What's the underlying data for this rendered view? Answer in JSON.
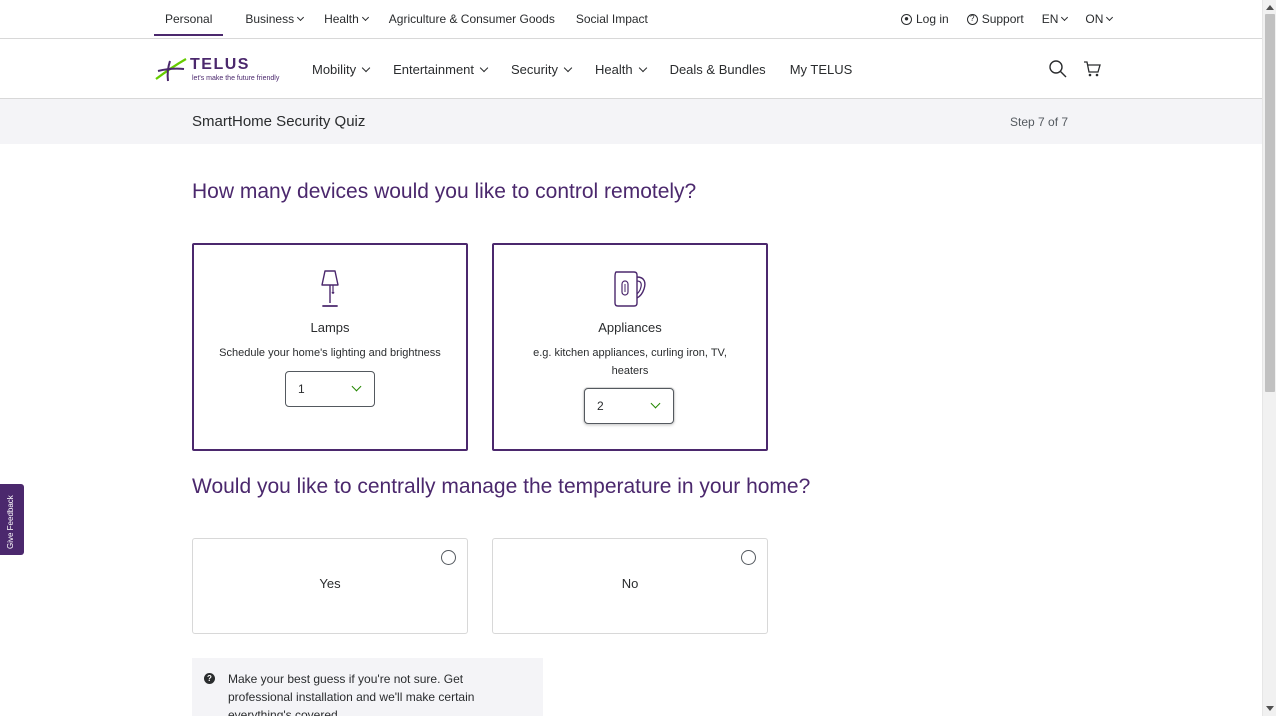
{
  "utility_nav": {
    "left": [
      {
        "label": "Personal",
        "dropdown": false,
        "active": true
      },
      {
        "label": "Business",
        "dropdown": true
      },
      {
        "label": "Health",
        "dropdown": true
      },
      {
        "label": "Agriculture & Consumer Goods",
        "dropdown": false
      },
      {
        "label": "Social Impact",
        "dropdown": false
      }
    ],
    "login": "Log in",
    "support": "Support",
    "language": "EN",
    "province": "ON"
  },
  "logo": {
    "word": "TELUS",
    "tagline": "let's make the future friendly"
  },
  "main_nav": {
    "items": [
      {
        "label": "Mobility",
        "dropdown": true
      },
      {
        "label": "Entertainment",
        "dropdown": true
      },
      {
        "label": "Security",
        "dropdown": true
      },
      {
        "label": "Health",
        "dropdown": true
      },
      {
        "label": "Deals & Bundles",
        "dropdown": false
      },
      {
        "label": "My TELUS",
        "dropdown": false
      }
    ],
    "icons": [
      "search-icon",
      "cart-icon"
    ]
  },
  "quiz": {
    "title": "SmartHome Security Quiz",
    "step": "Step 7 of 7"
  },
  "question1": {
    "text": "How many devices would you like to control remotely?",
    "cards": [
      {
        "label": "Lamps",
        "desc": "Schedule your home's lighting and brightness",
        "value": "1",
        "icon": "lamp-icon"
      },
      {
        "label": "Appliances",
        "desc": "e.g. kitchen appliances, curling iron, TV, heaters",
        "value": "2",
        "icon": "kettle-icon"
      }
    ]
  },
  "question2": {
    "text": "Would you like to centrally manage the temperature in your home?",
    "options": [
      {
        "label": "Yes"
      },
      {
        "label": "No"
      }
    ]
  },
  "hint": {
    "text": "Make your best guess if you're not sure. Get professional installation and we'll make certain everything's covered."
  },
  "feedback": {
    "label": "Give Feedback"
  },
  "colors": {
    "brand": "#4b286d",
    "accent": "#248700",
    "border": "#d8d8d8",
    "bar_bg": "#f4f4f7"
  }
}
